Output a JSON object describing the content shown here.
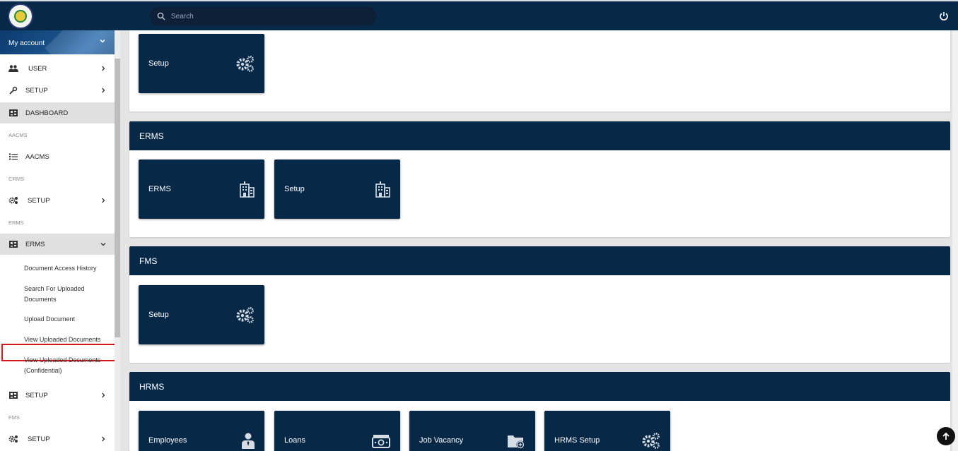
{
  "topbar": {
    "search_placeholder": "Search",
    "icons": {
      "logo": "org-seal-logo",
      "search": "search-icon",
      "power": "power-icon"
    }
  },
  "sidebar": {
    "account_label": "My account",
    "items": {
      "user": "USER",
      "setup1": "SETUP",
      "dashboard": "DASHBOARD",
      "aacms_section": "AACMS",
      "aacms": "AACMS",
      "crms_section": "CRMS",
      "crms_setup": "SETUP",
      "erms_section": "ERMS",
      "erms": "ERMS",
      "erms_sub": [
        "Document Access History",
        "Search For Uploaded Documents",
        "Upload Document",
        "View Uploaded Documents",
        "View Uploaded Documents (Confidential)"
      ],
      "erms_setup": "SETUP",
      "fms_section": "FMS",
      "fms_setup": "SETUP"
    }
  },
  "main": {
    "cards": [
      {
        "title": "",
        "tiles": [
          {
            "label": "Setup",
            "icon": "gears-icon"
          }
        ]
      },
      {
        "title": "ERMS",
        "tiles": [
          {
            "label": "ERMS",
            "icon": "building-icon"
          },
          {
            "label": "Setup",
            "icon": "building-icon"
          }
        ]
      },
      {
        "title": "FMS",
        "tiles": [
          {
            "label": "Setup",
            "icon": "gears-icon"
          }
        ]
      },
      {
        "title": "HRMS",
        "tiles": [
          {
            "label": "Employees",
            "icon": "employee-icon"
          },
          {
            "label": "Loans",
            "icon": "money-icon"
          },
          {
            "label": "Job Vacancy",
            "icon": "folder-plus-icon"
          },
          {
            "label": "HRMS Setup",
            "icon": "gears-icon"
          }
        ]
      }
    ]
  },
  "colors": {
    "navy": "#082848",
    "highlight": "#d5181e"
  }
}
